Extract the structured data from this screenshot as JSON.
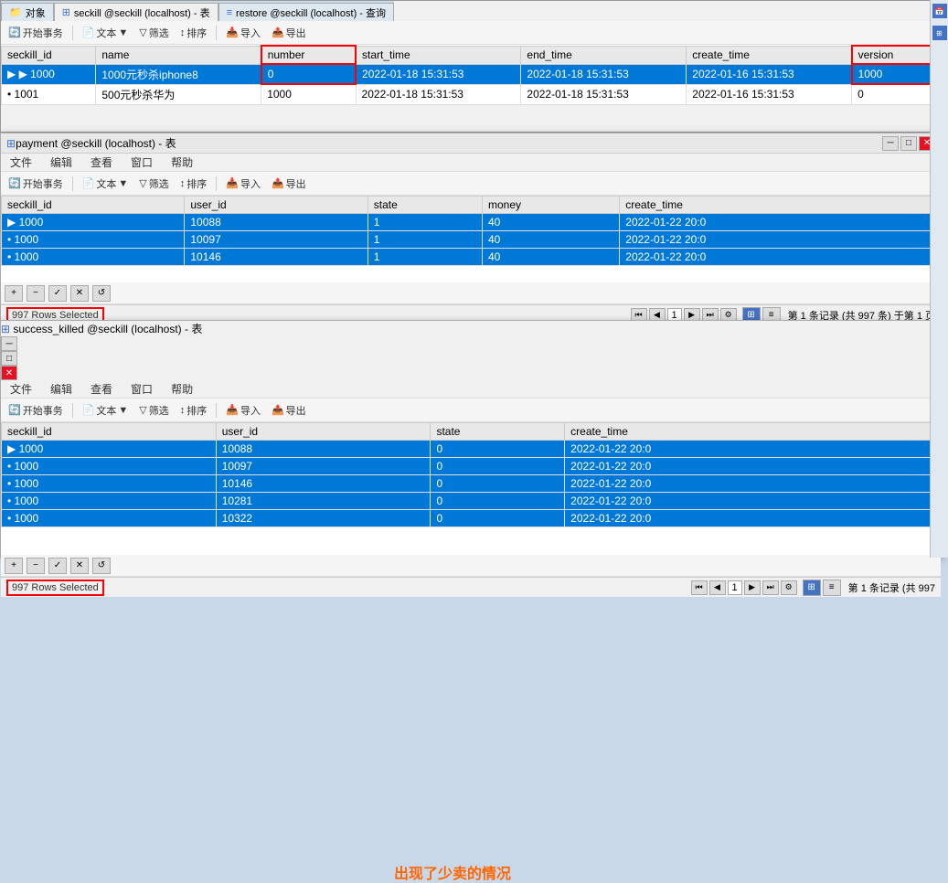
{
  "tabs": [
    {
      "label": "对象",
      "icon": "object-icon"
    },
    {
      "label": "seckill @seckill (localhost) - 表",
      "icon": "table-icon",
      "active": true
    },
    {
      "label": "restore @seckill (localhost) - 查询",
      "icon": "query-icon"
    }
  ],
  "seckill_table": {
    "title": "seckill @seckill (localhost) - 表",
    "toolbar": {
      "start_transaction": "开始事务",
      "text": "文本",
      "filter": "筛选",
      "sort": "排序",
      "import": "导入",
      "export": "导出"
    },
    "columns": [
      "seckill_id",
      "name",
      "number",
      "start_time",
      "end_time",
      "create_time",
      "version"
    ],
    "rows": [
      {
        "indicator": "arrow",
        "seckill_id": "1000",
        "name": "1000元秒杀iphone8",
        "number": "0",
        "start_time": "2022-01-18 15:31:53",
        "end_time": "2022-01-18 15:31:53",
        "create_time": "2022-01-16 15:31:53",
        "version": "1000"
      },
      {
        "indicator": "dot",
        "seckill_id": "1001",
        "name": "500元秒杀华为",
        "number": "1000",
        "start_time": "2022-01-18 15:31:53",
        "end_time": "2022-01-18 15:31:53",
        "create_time": "2022-01-16 15:31:53",
        "version": "0"
      }
    ],
    "highlighted_columns": [
      "number",
      "version"
    ]
  },
  "payment_window": {
    "title": "payment @seckill (localhost) - 表",
    "menubar": [
      "文件",
      "编辑",
      "查看",
      "窗口",
      "帮助"
    ],
    "toolbar": {
      "start_transaction": "开始事务",
      "text": "文本",
      "filter": "筛选",
      "sort": "排序",
      "import": "导入",
      "export": "导出"
    },
    "columns": [
      "seckill_id",
      "user_id",
      "state",
      "money",
      "create_time"
    ],
    "rows": [
      {
        "indicator": "arrow",
        "seckill_id": "1000",
        "user_id": "10088",
        "state": "1",
        "money": "40",
        "create_time": "2022-01-22 20:0"
      },
      {
        "indicator": "dot",
        "seckill_id": "1000",
        "user_id": "10097",
        "state": "1",
        "money": "40",
        "create_time": "2022-01-22 20:0"
      },
      {
        "indicator": "dot",
        "seckill_id": "1000",
        "user_id": "10146",
        "state": "1",
        "money": "40",
        "create_time": "2022-01-22 20:0"
      }
    ],
    "status": {
      "rows_selected": "997 Rows Selected",
      "pagination": "第 1 条记录 (共 997 条) 于第 1 页"
    }
  },
  "killed_window": {
    "title": "success_killed @seckill (localhost) - 表",
    "menubar": [
      "文件",
      "编辑",
      "查看",
      "窗口",
      "帮助"
    ],
    "toolbar": {
      "start_transaction": "开始事务",
      "text": "文本",
      "filter": "筛选",
      "sort": "排序",
      "import": "导入",
      "export": "导出"
    },
    "columns": [
      "seckill_id",
      "user_id",
      "state",
      "create_time"
    ],
    "rows": [
      {
        "indicator": "arrow",
        "seckill_id": "1000",
        "user_id": "10088",
        "state": "0",
        "create_time": "2022-01-22 20:0"
      },
      {
        "indicator": "dot",
        "seckill_id": "1000",
        "user_id": "10097",
        "state": "0",
        "create_time": "2022-01-22 20:0"
      },
      {
        "indicator": "dot",
        "seckill_id": "1000",
        "user_id": "10146",
        "state": "0",
        "create_time": "2022-01-22 20:0"
      },
      {
        "indicator": "dot",
        "seckill_id": "1000",
        "user_id": "10281",
        "state": "0",
        "create_time": "2022-01-22 20:0"
      },
      {
        "indicator": "dot",
        "seckill_id": "1000",
        "user_id": "10322",
        "state": "0",
        "create_time": "2022-01-22 20:0"
      }
    ],
    "annotation": "出现了少卖的情况",
    "status": {
      "rows_selected": "997 Rows Selected",
      "pagination": "第 1 条记录 (共 997"
    }
  },
  "icons": {
    "table": "⊞",
    "query": "≡",
    "plus": "+",
    "minus": "−",
    "check": "✓",
    "cross": "✕",
    "refresh": "↺",
    "prev_first": "⏮",
    "prev": "◀",
    "next": "▶",
    "next_last": "⏭",
    "grid": "⊞",
    "filter": "▽",
    "sort": "↕",
    "import": "⬇",
    "export": "⬆"
  }
}
